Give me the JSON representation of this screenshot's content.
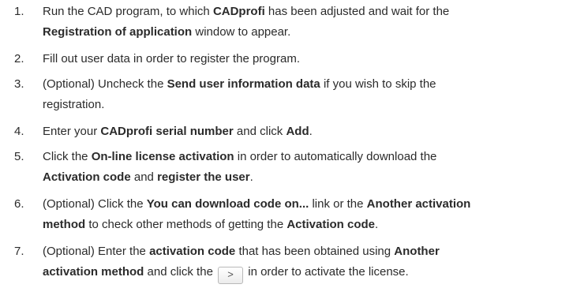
{
  "steps": [
    {
      "number": "1.",
      "lines": [
        [
          "Run the CAD program, to which ",
          {
            "b": "CADprofi"
          },
          " has been adjusted and wait for the"
        ],
        [
          {
            "b": "Registration of application"
          },
          " window to appear."
        ]
      ]
    },
    {
      "number": "2.",
      "lines": [
        [
          "Fill out user data in order to register the program."
        ]
      ]
    },
    {
      "number": "3.",
      "lines": [
        [
          "(Optional) Uncheck the ",
          {
            "b": "Send user information data"
          },
          " if you wish to skip the"
        ],
        [
          "registration."
        ]
      ]
    },
    {
      "number": "4.",
      "lines": [
        [
          "Enter your ",
          {
            "b": "CADprofi serial number"
          },
          " and click ",
          {
            "b": "Add"
          },
          "."
        ]
      ]
    },
    {
      "number": "5.",
      "lines": [
        [
          "Click the ",
          {
            "b": "On-line license activation"
          },
          " in order to automatically download the"
        ],
        [
          {
            "b": "Activation code"
          },
          " and ",
          {
            "b": "register the user"
          },
          "."
        ]
      ]
    },
    {
      "number": "6.",
      "lines": [
        [
          "(Optional) Click the ",
          {
            "b": "You can download code on..."
          },
          " link or the ",
          {
            "b": "Another activation"
          }
        ],
        [
          {
            "b": "method"
          },
          " to check other methods of getting the ",
          {
            "b": "Activation code"
          },
          "."
        ]
      ]
    },
    {
      "number": "7.",
      "lines": [
        [
          "(Optional) Enter the ",
          {
            "b": "activation code"
          },
          " that has been obtained using ",
          {
            "b": "Another"
          }
        ],
        [
          {
            "b": "activation method"
          },
          " and click the ",
          {
            "btn": ">"
          },
          " in order to activate the license."
        ]
      ]
    }
  ]
}
